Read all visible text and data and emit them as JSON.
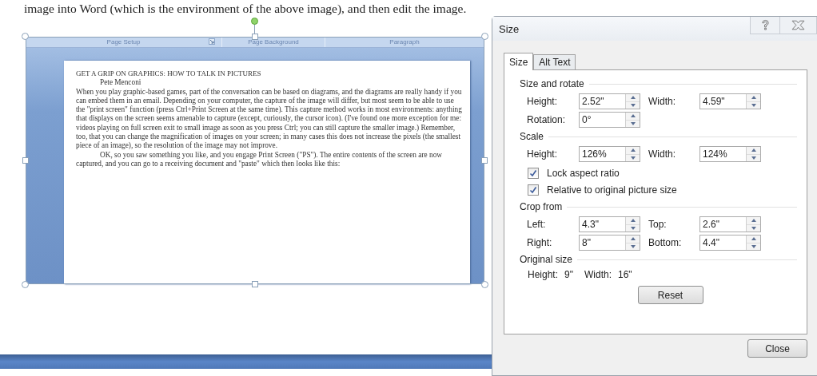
{
  "intro_text": "image into Word (which is the environment of the above image), and then edit the image.",
  "embedded_screenshot": {
    "ribbon_groups": [
      {
        "label": "Page Setup",
        "has_launcher": true
      },
      {
        "label": "Page Background",
        "has_launcher": false
      },
      {
        "label": "Paragraph",
        "has_launcher": false
      }
    ],
    "document": {
      "title": "GET A GRIP ON GRAPHICS:  HOW TO TALK IN PICTURES",
      "author": "Pete Menconi",
      "paragraphs": [
        {
          "text": "When you play graphic-based games, part of the conversation can be based on diagrams, and the diagrams are really handy if you can embed them in an email.  Depending on your computer, the capture of the image will differ, but most seem to be able to use the \"print screen\" function (press Ctrl+Print Screen at the same time).  This capture method works in most environments:  anything that displays on the screen seems amenable to capture (except, curiously, the cursor icon).  (I've found one more exception for me:  videos playing on full screen exit to small image as soon as you press Ctrl; you can still capture the smaller image.)  Remember, too, that you can change the magnification of images on your screen; in many cases this does not increase the pixels (the smallest piece of an image), so the resolution of the image may not improve.",
          "indented": false
        },
        {
          "text": "OK, so you saw something you like, and you engage Print Screen (\"PS\").  The entire contents of the screen are now captured, and you can go to a receiving document and \"paste\" which then looks like this:",
          "indented": true
        }
      ]
    }
  },
  "dialog": {
    "title": "Size",
    "tabs": [
      {
        "label": "Size",
        "selected": true
      },
      {
        "label": "Alt Text",
        "selected": false
      }
    ],
    "size_and_rotate": {
      "heading": "Size and rotate",
      "rows": [
        [
          {
            "label": "Height:",
            "value": "2.52\""
          },
          {
            "label": "Width:",
            "value": "4.59\""
          }
        ],
        [
          {
            "label": "Rotation:",
            "value": "0°"
          }
        ]
      ]
    },
    "scale": {
      "heading": "Scale",
      "rows": [
        [
          {
            "label": "Height:",
            "value": "126%"
          },
          {
            "label": "Width:",
            "value": "124%"
          }
        ]
      ],
      "checkboxes": [
        {
          "label": "Lock aspect ratio",
          "checked": true
        },
        {
          "label": "Relative to original picture size",
          "checked": true
        }
      ]
    },
    "crop_from": {
      "heading": "Crop from",
      "rows": [
        [
          {
            "label": "Left:",
            "value": "4.3\""
          },
          {
            "label": "Top:",
            "value": "2.6\""
          }
        ],
        [
          {
            "label": "Right:",
            "value": "8\""
          },
          {
            "label": "Bottom:",
            "value": "4.4\""
          }
        ]
      ]
    },
    "original_size": {
      "heading": "Original size",
      "items": [
        {
          "label": "Height:",
          "value": "9\""
        },
        {
          "label": "Width:",
          "value": "16\""
        }
      ]
    },
    "reset_button": "Reset",
    "close_button": "Close"
  }
}
